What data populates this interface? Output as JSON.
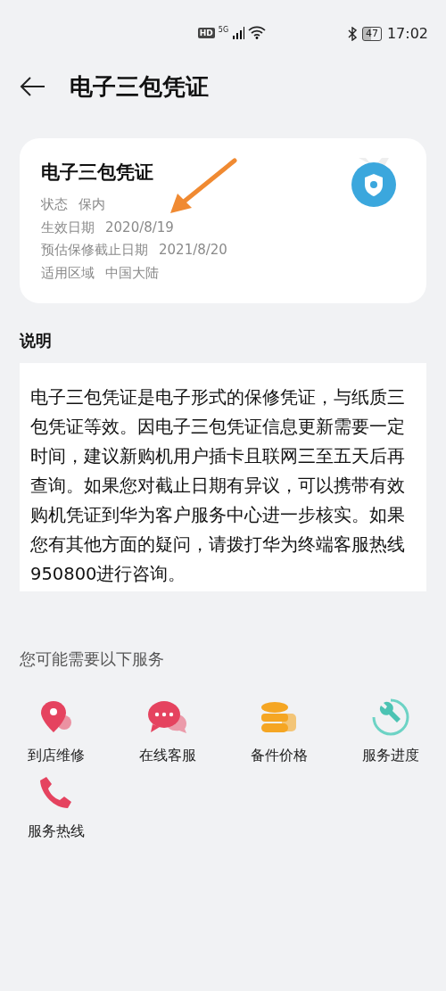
{
  "status_bar": {
    "hd": "HD",
    "network": "5G",
    "battery": "47",
    "time": "17:02"
  },
  "header": {
    "title": "电子三包凭证"
  },
  "card": {
    "title": "电子三包凭证",
    "rows": [
      {
        "label": "状态",
        "value": "保内"
      },
      {
        "label": "生效日期",
        "value": "2020/8/19"
      },
      {
        "label": "预估保修截止日期",
        "value": "2021/8/20"
      },
      {
        "label": "适用区域",
        "value": "中国大陆"
      }
    ]
  },
  "description": {
    "heading": "说明",
    "text": "电子三包凭证是电子形式的保修凭证，与纸质三包凭证等效。因电子三包凭证信息更新需要一定时间，建议新购机用户插卡且联网三至五天后再查询。如果您对截止日期有异议，可以携带有效购机凭证到华为客户服务中心进一步核实。如果您有其他方面的疑问，请拨打华为终端客服热线950800进行咨询。"
  },
  "services": {
    "heading": "您可能需要以下服务",
    "items": [
      {
        "kind": "pin",
        "label": "到店维修"
      },
      {
        "kind": "chat",
        "label": "在线客服"
      },
      {
        "kind": "coins",
        "label": "备件价格"
      },
      {
        "kind": "progress",
        "label": "服务进度"
      },
      {
        "kind": "phone",
        "label": "服务热线"
      }
    ]
  }
}
